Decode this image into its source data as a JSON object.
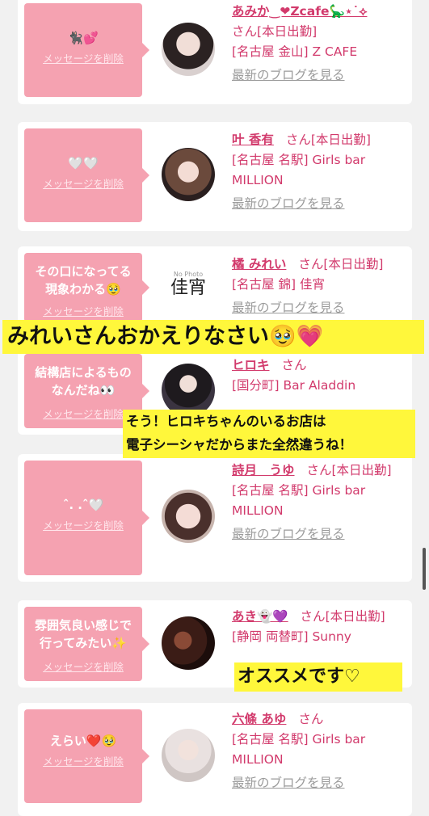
{
  "cards": [
    {
      "message": "🐈‍⬛💕",
      "delete_label": "メッセージを削除",
      "name": "あみか‿❤︎Zcafe🦕⋆˙⟡",
      "honorific": "さん",
      "status": "[本日出勤]",
      "shop": "[名古屋 金山] Z CAFE",
      "blog_link": "最新のブログを見る"
    },
    {
      "message": "🤍🤍",
      "delete_label": "メッセージを削除",
      "name": "叶 香有",
      "honorific": "さん",
      "status": "[本日出勤]",
      "shop": "[名古屋 名駅] Girls bar MILLION",
      "blog_link": "最新のブログを見る"
    },
    {
      "message": "その口になってる\n現象わかる🥹",
      "delete_label": "メッセージを削除",
      "name": "橘 みれい",
      "honorific": "さん",
      "status": "[本日出勤]",
      "shop": "[名古屋 錦] 佳宵",
      "blog_link": "最新のブログを見る",
      "avatar_text_small": "No Photo",
      "avatar_text_large": "佳宵"
    },
    {
      "message": "結構店によるもの\nなんだね👀",
      "delete_label": "メッセージを削除",
      "name": "ヒロキ",
      "honorific": "さん",
      "status": "",
      "shop": "[国分町] Bar Aladdin",
      "blog_link": ""
    },
    {
      "message": "ˆ. .ˆ🤍",
      "delete_label": "メッセージを削除",
      "name": "詩月　うゆ",
      "honorific": "さん",
      "status": "[本日出勤]",
      "shop": "[名古屋 名駅] Girls bar MILLION",
      "blog_link": "最新のブログを見る"
    },
    {
      "message": "雰囲気良い感じで\n行ってみたい✨",
      "delete_label": "メッセージを削除",
      "name": "あき👻💜",
      "honorific": "さん",
      "status": "[本日出勤]",
      "shop": "[静岡 両替町] Sunny",
      "blog_link": ""
    },
    {
      "message": "えらい❤️🥹",
      "delete_label": "メッセージを削除",
      "name": "六條 あゆ",
      "honorific": "さん",
      "status": "",
      "shop": "[名古屋 名駅] Girls bar MILLION",
      "blog_link": "最新のブログを見る"
    }
  ],
  "overlays": {
    "caption1": "みれいさんおかえりなさい🥹💗",
    "caption2_line1": "そう！ヒロキちゃんのいるお店は",
    "caption2_line2": "電子シーシャだからまた全然違うね！",
    "caption3": "オススメです♡"
  },
  "colors": {
    "accent": "#d23a6c",
    "bubble": "#f5a2b1",
    "highlight": "#fff73b",
    "background": "#f1f1f1"
  }
}
